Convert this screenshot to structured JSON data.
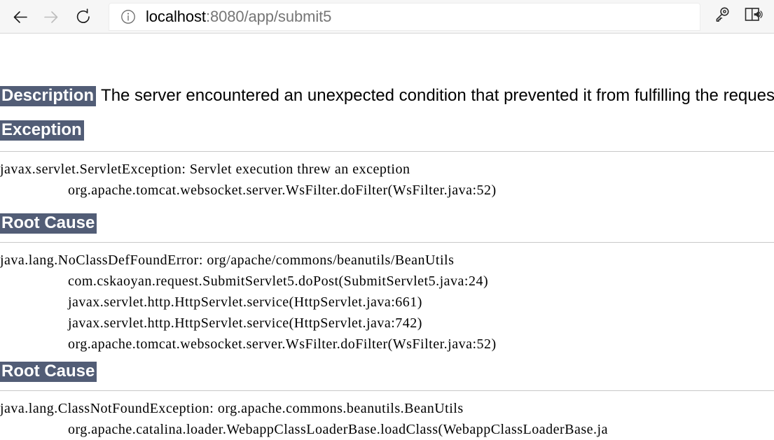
{
  "browser": {
    "back_label": "Back",
    "forward_label": "Forward",
    "refresh_label": "Refresh",
    "address": {
      "info_icon": "info-icon",
      "host": "localhost",
      "rest": ":8080/app/submit5",
      "full_url": "localhost:8080/app/submit5"
    },
    "right_tools": [
      {
        "name": "key-icon",
        "label": "Save password / key"
      },
      {
        "name": "read-aloud-icon",
        "label": "Read aloud"
      }
    ]
  },
  "page": {
    "description": {
      "heading": "Description",
      "text": "The server encountered an unexpected condition that prevented it from fulfilling the request."
    },
    "exception": {
      "heading": "Exception",
      "lines": [
        "javax.servlet.ServletException: Servlet execution threw an exception",
        "org.apache.tomcat.websocket.server.WsFilter.doFilter(WsFilter.java:52)"
      ]
    },
    "root_cause_1": {
      "heading": "Root Cause",
      "lines": [
        "java.lang.NoClassDefFoundError: org/apache/commons/beanutils/BeanUtils",
        "com.cskaoyan.request.SubmitServlet5.doPost(SubmitServlet5.java:24)",
        "javax.servlet.http.HttpServlet.service(HttpServlet.java:661)",
        "javax.servlet.http.HttpServlet.service(HttpServlet.java:742)",
        "org.apache.tomcat.websocket.server.WsFilter.doFilter(WsFilter.java:52)"
      ]
    },
    "root_cause_2": {
      "heading": "Root Cause",
      "lines": [
        "java.lang.ClassNotFoundException: org.apache.commons.beanutils.BeanUtils",
        "org.apache.catalina.loader.WebappClassLoaderBase.loadClass(WebappClassLoaderBase.ja"
      ]
    }
  },
  "colors": {
    "heading_background": "#525D76",
    "heading_text": "#FFFFFF",
    "body_text": "#000000",
    "toolbar_background": "#F6F6F6",
    "url_host_text": "#000000",
    "url_rest_text": "#767676"
  }
}
